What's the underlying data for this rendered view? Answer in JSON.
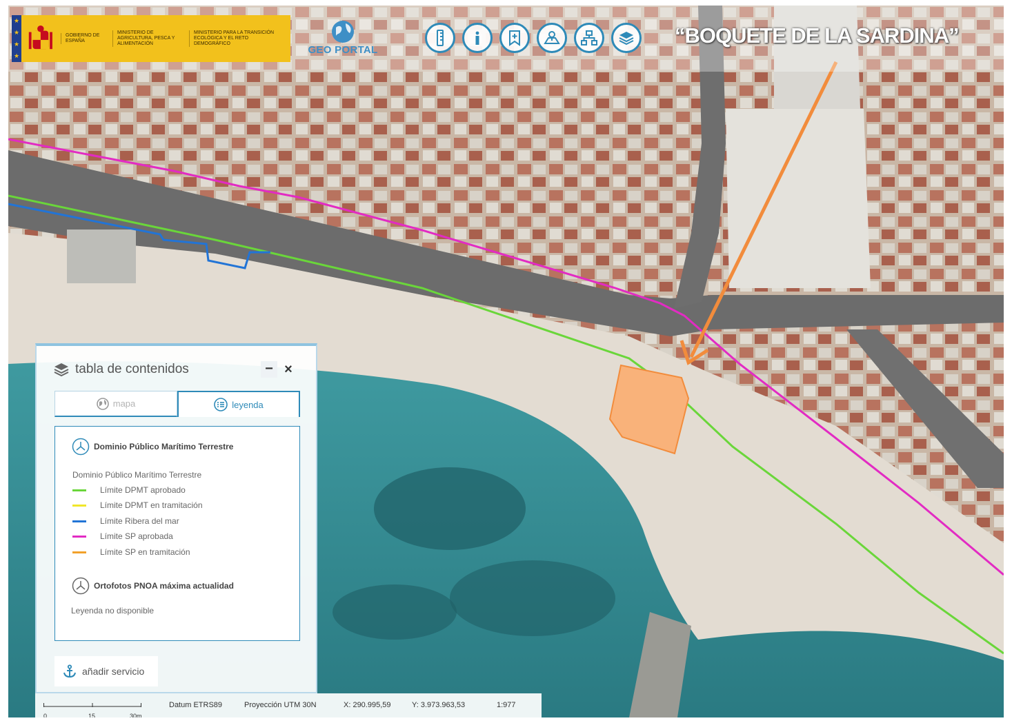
{
  "header": {
    "government_label": "GOBIERNO DE ESPAÑA",
    "ministry_1": "MINISTERIO DE AGRICULTURA, PESCA Y ALIMENTACIÓN",
    "ministry_2": "MINISTERIO PARA LA TRANSICIÓN ECOLÓGICA Y EL RETO DEMOGRÁFICO",
    "portal_name": "GEO PORTAL",
    "map_title": "“BOQUETE DE LA SARDINA”",
    "toolbar_icons": [
      "ruler-icon",
      "info-icon",
      "bookmark-add-icon",
      "map-pin-icon",
      "hierarchy-icon",
      "layers-icon"
    ]
  },
  "toc": {
    "title": "tabla de contenidos",
    "minimize_label": "−",
    "close_label": "×",
    "tabs": [
      {
        "label": "mapa",
        "active": false
      },
      {
        "label": "leyenda",
        "active": true
      }
    ],
    "layers": [
      {
        "name": "Dominio Público Marítimo Terrestre",
        "subtitle": "Dominio Público Marítimo Terrestre",
        "items": [
          {
            "label": "Límite DPMT aprobado",
            "color": "#6ad63a"
          },
          {
            "label": "Límite DPMT en tramitación",
            "color": "#f0e62a"
          },
          {
            "label": "Límite Ribera del mar",
            "color": "#2274d6"
          },
          {
            "label": "Límite SP aprobada",
            "color": "#e22bc3"
          },
          {
            "label": "Límite SP en tramitación",
            "color": "#f2a12a"
          }
        ]
      },
      {
        "name": "Ortofotos PNOA máxima actualidad",
        "subtitle": "Leyenda no disponible"
      }
    ],
    "add_service_label": "añadir servicio"
  },
  "status_bar": {
    "scale_ticks": [
      "0",
      "15",
      "30m"
    ],
    "datum": "Datum ETRS89",
    "projection": "Proyección UTM 30N",
    "x_coord": "X: 290.995,59",
    "y_coord": "Y: 3.973.963,53",
    "scale": "1:977"
  },
  "colors": {
    "accent": "#2e8ab8",
    "annotation_arrow": "#f28c3c",
    "annotation_polygon": "#f9b27a"
  }
}
